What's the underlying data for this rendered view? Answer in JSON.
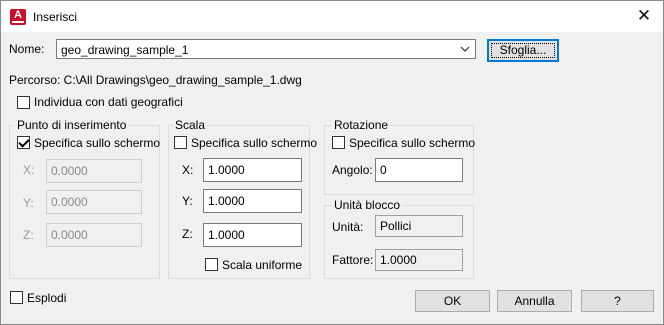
{
  "window": {
    "title": "Inserisci",
    "app_icon": "autocad-icon",
    "close_glyph": "✕"
  },
  "name": {
    "label": "Nome:",
    "value": "geo_drawing_sample_1",
    "browse_label": "Sfoglia..."
  },
  "path": {
    "text": "Percorso: C:\\All Drawings\\geo_drawing_sample_1.dwg"
  },
  "geo": {
    "label": "Individua con dati geografici",
    "checked": false
  },
  "insertion_point": {
    "title": "Punto di inserimento",
    "specify_label": "Specifica sullo schermo",
    "specify_checked": true,
    "x_label": "X:",
    "x_value": "0.0000",
    "y_label": "Y:",
    "y_value": "0.0000",
    "z_label": "Z:",
    "z_value": "0.0000"
  },
  "scale": {
    "title": "Scala",
    "specify_label": "Specifica sullo schermo",
    "specify_checked": false,
    "x_label": "X:",
    "x_value": "1.0000",
    "y_label": "Y:",
    "y_value": "1.0000",
    "z_label": "Z:",
    "z_value": "1.0000",
    "uniform_label": "Scala uniforme",
    "uniform_checked": false
  },
  "rotation": {
    "title": "Rotazione",
    "specify_label": "Specifica sullo schermo",
    "specify_checked": false,
    "angle_label": "Angolo:",
    "angle_value": "0"
  },
  "block_unit": {
    "title": "Unità blocco",
    "unit_label": "Unità:",
    "unit_value": "Pollici",
    "factor_label": "Fattore:",
    "factor_value": "1.0000"
  },
  "explode": {
    "label": "Esplodi",
    "checked": false
  },
  "buttons": {
    "ok": "OK",
    "cancel": "Annulla",
    "help": "?"
  }
}
